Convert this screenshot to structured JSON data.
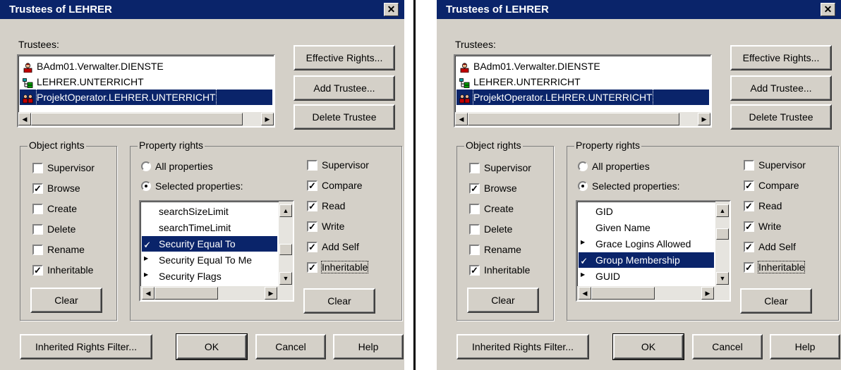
{
  "dialogs": [
    {
      "title": "Trustees of LEHRER",
      "trustees_label": "Trustees:",
      "trustees": [
        {
          "name": "BAdm01.Verwalter.DIENSTE",
          "icon": "user-icon"
        },
        {
          "name": "LEHRER.UNTERRICHT",
          "icon": "org-unit-icon"
        },
        {
          "name": "ProjektOperator.LEHRER.UNTERRICHT",
          "icon": "group-icon",
          "selected": true
        }
      ],
      "buttons": {
        "effective_rights": "Effective Rights...",
        "add_trustee": "Add Trustee...",
        "delete_trustee": "Delete Trustee",
        "inherited_rights_filter": "Inherited Rights Filter...",
        "ok": "OK",
        "cancel": "Cancel",
        "help": "Help",
        "clear_object": "Clear",
        "clear_property": "Clear"
      },
      "object_rights": {
        "title": "Object rights",
        "items": [
          {
            "label": "Supervisor",
            "checked": false
          },
          {
            "label": "Browse",
            "checked": true
          },
          {
            "label": "Create",
            "checked": false
          },
          {
            "label": "Delete",
            "checked": false
          },
          {
            "label": "Rename",
            "checked": false
          },
          {
            "label": "Inheritable",
            "checked": true
          }
        ]
      },
      "property_rights": {
        "title": "Property rights",
        "radio_all": "All properties",
        "radio_selected": "Selected properties:",
        "selected_option": "selected",
        "properties": [
          {
            "name": "searchSizeLimit",
            "marker": "",
            "selected": false
          },
          {
            "name": "searchTimeLimit",
            "marker": "",
            "selected": false
          },
          {
            "name": "Security Equal To",
            "marker": "check",
            "selected": true
          },
          {
            "name": "Security Equal To Me",
            "marker": "triangle",
            "selected": false
          },
          {
            "name": "Security Flags",
            "marker": "triangle",
            "selected": false
          }
        ],
        "checks": [
          {
            "label": "Supervisor",
            "checked": false
          },
          {
            "label": "Compare",
            "checked": true
          },
          {
            "label": "Read",
            "checked": true
          },
          {
            "label": "Write",
            "checked": true
          },
          {
            "label": "Add Self",
            "checked": true
          },
          {
            "label": "Inheritable",
            "checked": true
          }
        ]
      }
    },
    {
      "title": "Trustees of LEHRER",
      "trustees_label": "Trustees:",
      "trustees": [
        {
          "name": "BAdm01.Verwalter.DIENSTE",
          "icon": "user-icon"
        },
        {
          "name": "LEHRER.UNTERRICHT",
          "icon": "org-unit-icon"
        },
        {
          "name": "ProjektOperator.LEHRER.UNTERRICHT",
          "icon": "group-icon",
          "selected": true
        }
      ],
      "buttons": {
        "effective_rights": "Effective Rights...",
        "add_trustee": "Add Trustee...",
        "delete_trustee": "Delete Trustee",
        "inherited_rights_filter": "Inherited Rights Filter...",
        "ok": "OK",
        "cancel": "Cancel",
        "help": "Help",
        "clear_object": "Clear",
        "clear_property": "Clear"
      },
      "object_rights": {
        "title": "Object rights",
        "items": [
          {
            "label": "Supervisor",
            "checked": false
          },
          {
            "label": "Browse",
            "checked": true
          },
          {
            "label": "Create",
            "checked": false
          },
          {
            "label": "Delete",
            "checked": false
          },
          {
            "label": "Rename",
            "checked": false
          },
          {
            "label": "Inheritable",
            "checked": true
          }
        ]
      },
      "property_rights": {
        "title": "Property rights",
        "radio_all": "All properties",
        "radio_selected": "Selected properties:",
        "selected_option": "selected",
        "properties": [
          {
            "name": "GID",
            "marker": "",
            "selected": false
          },
          {
            "name": "Given Name",
            "marker": "",
            "selected": false
          },
          {
            "name": "Grace Logins Allowed",
            "marker": "triangle",
            "selected": false
          },
          {
            "name": "Group Membership",
            "marker": "check",
            "selected": true
          },
          {
            "name": "GUID",
            "marker": "triangle",
            "selected": false
          }
        ],
        "checks": [
          {
            "label": "Supervisor",
            "checked": false
          },
          {
            "label": "Compare",
            "checked": true
          },
          {
            "label": "Read",
            "checked": true
          },
          {
            "label": "Write",
            "checked": true
          },
          {
            "label": "Add Self",
            "checked": true
          },
          {
            "label": "Inheritable",
            "checked": true
          }
        ]
      }
    }
  ],
  "colors": {
    "dialog_face": "#d4d0c8",
    "title_bar": "#0a246a",
    "selection": "#0a246a"
  }
}
